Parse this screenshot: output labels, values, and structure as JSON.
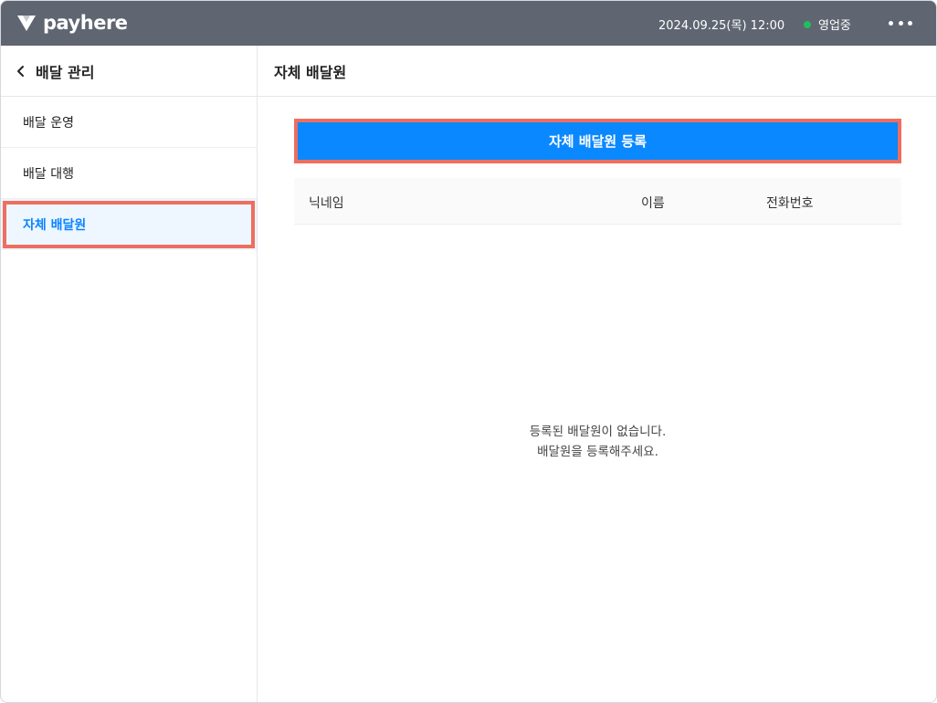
{
  "header": {
    "brand": "payhere",
    "datetime": "2024.09.25(목) 12:00",
    "status_label": "영업중",
    "status_color": "#1fbf60",
    "more_icon": "more-horizontal-icon"
  },
  "sidebar": {
    "title": "배달 관리",
    "back_icon": "chevron-left-icon",
    "items": [
      {
        "label": "배달 운영",
        "active": false
      },
      {
        "label": "배달 대행",
        "active": false
      },
      {
        "label": "자체 배달원",
        "active": true
      }
    ]
  },
  "main": {
    "title": "자체 배달원",
    "register_button": "자체 배달원 등록",
    "table": {
      "columns": [
        "닉네임",
        "이름",
        "전화번호"
      ],
      "rows": []
    },
    "empty_line1": "등록된 배달원이 없습니다.",
    "empty_line2": "배달원을 등록해주세요."
  },
  "colors": {
    "header_bg": "#5f6571",
    "accent": "#0a88ff",
    "highlight_border": "#ee6e5f",
    "active_bg": "#eef6ff"
  }
}
